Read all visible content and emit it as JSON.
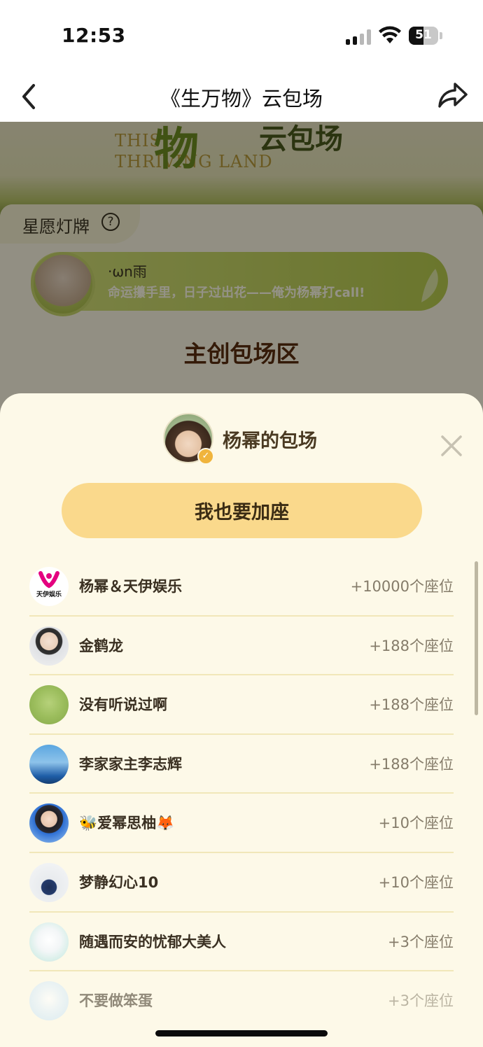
{
  "status_bar": {
    "time": "12:53",
    "battery_level": "51"
  },
  "nav": {
    "title": "《生万物》云包场",
    "back_icon": "chevron-left-icon",
    "share_icon": "share-arrow-icon"
  },
  "background_page": {
    "banner_en": "THIS\nTHRIVING LAND",
    "banner_cn_1": "物",
    "banner_cn_2": "云包场",
    "lamp_title": "星愿灯牌",
    "wish_name": "·ωn雨",
    "wish_message": "命运攥手里，日子过出花——俺为杨幂打call!",
    "zone_title": "主创包场区"
  },
  "sheet": {
    "host_title": "杨幂的包场",
    "verified_badge": "✓",
    "join_label": "我也要加座",
    "close_icon": "close-x-icon",
    "logo_text": "天伊娱乐",
    "rows": [
      {
        "name": "杨幂＆天伊娱乐",
        "seats": "+10000个座位"
      },
      {
        "name": "金鹤龙",
        "seats": "+188个座位"
      },
      {
        "name": "没有听说过啊",
        "seats": "+188个座位"
      },
      {
        "name": "李家家主李志辉",
        "seats": "+188个座位"
      },
      {
        "name": "🐝爱幂思柚🦊",
        "seats": "+10个座位"
      },
      {
        "name": "梦静幻心10",
        "seats": "+10个座位"
      },
      {
        "name": "随遇而安的忧郁大美人",
        "seats": "+3个座位"
      },
      {
        "name": "不要做笨蛋",
        "seats": "+3个座位"
      }
    ]
  },
  "colors": {
    "sheet_bg": "#fdf9e8",
    "join_button": "#fad98c",
    "divider": "#f1e7b9",
    "zone_title": "#5a2e0e"
  }
}
